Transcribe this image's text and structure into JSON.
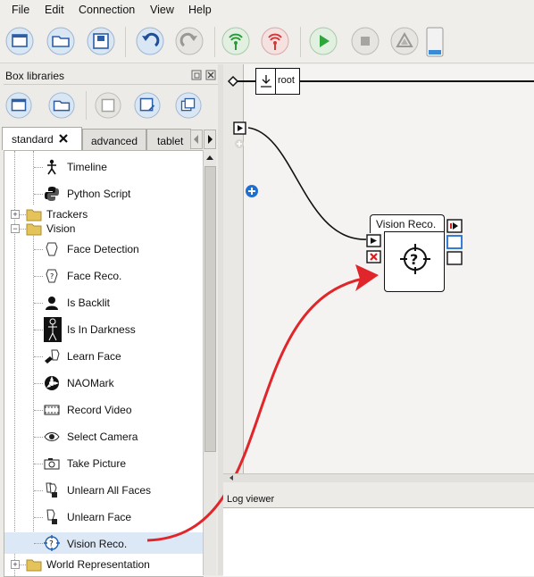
{
  "menubar": {
    "items": [
      "File",
      "Edit",
      "Connection",
      "View",
      "Help"
    ]
  },
  "toolbar": {
    "buttons": [
      "new-icon",
      "open-icon",
      "save-icon",
      "undo-icon",
      "redo-icon",
      "connect-icon",
      "disconnect-icon",
      "play-icon",
      "stop-icon",
      "warning-icon",
      "battery-icon"
    ]
  },
  "box_libraries": {
    "title": "Box libraries",
    "tabs": [
      "standard",
      "advanced",
      "tablet"
    ],
    "tree": [
      {
        "label": "Timeline",
        "icon": "timeline-icon",
        "level": 2
      },
      {
        "label": "Python Script",
        "icon": "python-icon",
        "level": 2
      },
      {
        "label": "Trackers",
        "icon": "folder-icon",
        "level": 1
      },
      {
        "label": "Vision",
        "icon": "folder-icon",
        "level": 1
      },
      {
        "label": "Face Detection",
        "icon": "face-detection-icon",
        "level": 2
      },
      {
        "label": "Face Reco.",
        "icon": "face-reco-icon",
        "level": 2
      },
      {
        "label": "Is Backlit",
        "icon": "backlit-icon",
        "level": 2
      },
      {
        "label": "Is In Darkness",
        "icon": "darkness-icon",
        "level": 2
      },
      {
        "label": "Learn Face",
        "icon": "learn-face-icon",
        "level": 2
      },
      {
        "label": "NAOMark",
        "icon": "naomark-icon",
        "level": 2
      },
      {
        "label": "Record Video",
        "icon": "record-video-icon",
        "level": 2
      },
      {
        "label": "Select Camera",
        "icon": "select-camera-icon",
        "level": 2
      },
      {
        "label": "Take Picture",
        "icon": "take-picture-icon",
        "level": 2
      },
      {
        "label": "Unlearn All Faces",
        "icon": "unlearn-all-icon",
        "level": 2
      },
      {
        "label": "Unlearn Face",
        "icon": "unlearn-face-icon",
        "level": 2
      },
      {
        "label": "Vision Reco.",
        "icon": "vision-reco-icon",
        "level": 2
      },
      {
        "label": "World Representation",
        "icon": "folder-icon",
        "level": 1
      }
    ]
  },
  "flow": {
    "breadcrumb": "root",
    "box_title": "Vision Reco."
  },
  "log": {
    "title": "Log viewer"
  },
  "colors": {
    "arrow": "#e0262b",
    "selection": "#dde8f6",
    "blue_plus": "#1f6fd1"
  }
}
